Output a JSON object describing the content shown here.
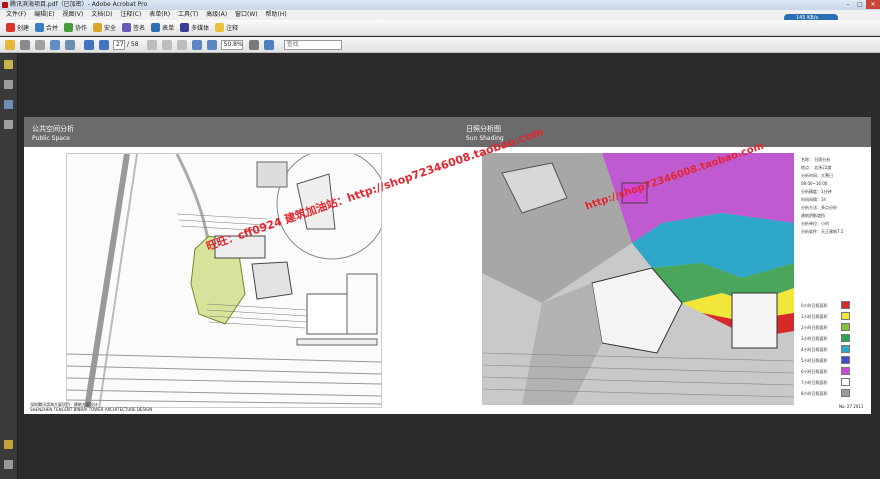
{
  "window": {
    "title": "腾讯滨海项目.pdf（已加密）- Adobe Acrobat Pro",
    "network_speed": "145 KB/s"
  },
  "menu": [
    "文件(F)",
    "编辑(E)",
    "视图(V)",
    "文档(D)",
    "注释(C)",
    "表单(R)",
    "工具(T)",
    "高级(A)",
    "窗口(W)",
    "帮助(H)"
  ],
  "toolbar1": [
    {
      "label": "创建",
      "icon": "create-icon"
    },
    {
      "label": "合并",
      "icon": "combine-icon"
    },
    {
      "label": "协作",
      "icon": "collaborate-icon"
    },
    {
      "label": "安全",
      "icon": "lock-icon"
    },
    {
      "label": "签名",
      "icon": "sign-icon"
    },
    {
      "label": "表单",
      "icon": "form-icon"
    },
    {
      "label": "多媒体",
      "icon": "multimedia-icon"
    },
    {
      "label": "注释",
      "icon": "comment-icon"
    }
  ],
  "toolbar2": {
    "page_current": "27",
    "page_total": "/ 58",
    "zoom": "50.8%",
    "search_placeholder": "查找"
  },
  "page": {
    "left_title_cn": "公共空间分析",
    "left_title_en": "Public Space",
    "right_title_cn": "日照分析图",
    "right_title_en": "Sun Shading",
    "footer_cn": "深圳腾讯滨海大厦项目 · 建筑方案设计",
    "footer_en": "SHENZHEN TENCENT BINHAI TOWER ARCHITECTURE DESIGN",
    "page_no": "No. 27  2011",
    "watermark_left": "旺旺：cff0924  建筑加油站：http://shop72346008.taobao.com",
    "watermark_right": "http://shop72346008.taobao.com",
    "legend_info": [
      "名称：  日照分析",
      "地点：  北纬22度",
      "分析时间：大寒日",
      "  08:00~16:00",
      "分析精度：1分钟",
      "时间间隔：1h",
      "分析方法：多点分析",
      "  建筑阴影遮挡",
      "分析单位：小时",
      "分析软件：天正建筑7.5"
    ],
    "legend_items": [
      {
        "label": "0小时日照面积",
        "color": "#d62a2a"
      },
      {
        "label": "1小时日照面积",
        "color": "#f2e63a"
      },
      {
        "label": "2小时日照面积",
        "color": "#83c238"
      },
      {
        "label": "3小时日照面积",
        "color": "#29a853"
      },
      {
        "label": "4小时日照面积",
        "color": "#2ea7c9"
      },
      {
        "label": "5小时日照面积",
        "color": "#3e4fc6"
      },
      {
        "label": "6小时日照面积",
        "color": "#cc4ad6"
      },
      {
        "label": "7小时日照面积",
        "color": "#ffffff"
      },
      {
        "label": "8小时日照面积",
        "color": "#9a9a9a"
      }
    ]
  }
}
